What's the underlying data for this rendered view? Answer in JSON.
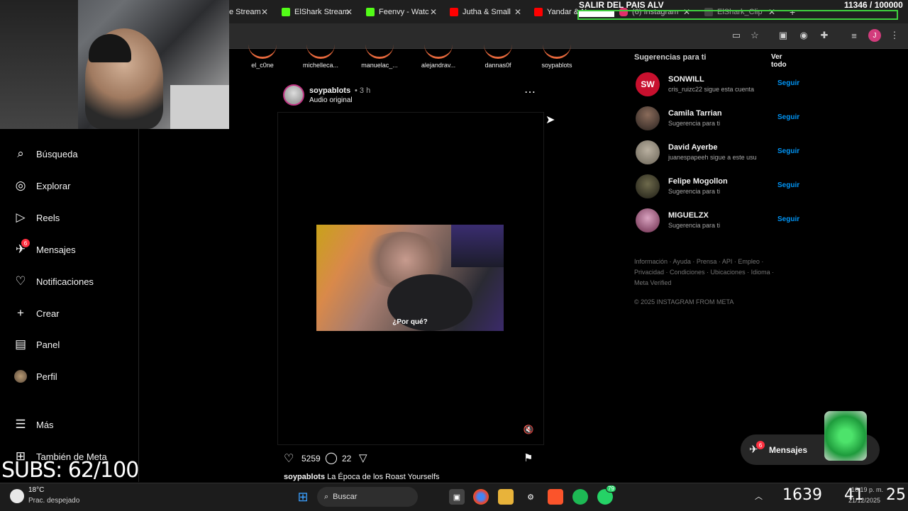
{
  "browser": {
    "tabs": [
      {
        "label": "e Stream",
        "color": "#ffffff"
      },
      {
        "label": "ElShark Stream",
        "color": "#53fc18"
      },
      {
        "label": "Feenvy - Watc",
        "color": "#53fc18"
      },
      {
        "label": "Jutha & Small",
        "color": "#ff0000"
      },
      {
        "label": "Yandar & N",
        "color": "#ff0000"
      },
      {
        "label": "(6) Instagram",
        "color": "#e1306c"
      },
      {
        "label": "ElShark_Clip",
        "color": "#ffffff"
      }
    ]
  },
  "overlay": {
    "stream_title": "SALIR DEL PAIS ALV",
    "counter": "11346 / 100000",
    "subs": "SUBS: 62/100"
  },
  "sidebar": {
    "items": [
      {
        "label": "Búsqueda",
        "icon": "search-icon"
      },
      {
        "label": "Explorar",
        "icon": "compass-icon"
      },
      {
        "label": "Reels",
        "icon": "reels-icon"
      },
      {
        "label": "Mensajes",
        "icon": "messenger-icon",
        "badge": "6"
      },
      {
        "label": "Notificaciones",
        "icon": "heart-icon"
      },
      {
        "label": "Crear",
        "icon": "plus-icon"
      },
      {
        "label": "Panel",
        "icon": "chart-icon"
      },
      {
        "label": "Perfil",
        "icon": "avatar-icon"
      },
      {
        "label": "Más",
        "icon": "menu-icon"
      },
      {
        "label": "También de Meta",
        "icon": "meta-icon"
      }
    ]
  },
  "stories": [
    "el_c0ne",
    "michelleca...",
    "manuelac_...",
    "alejandrav...",
    "dannas0f",
    "soypablots"
  ],
  "post": {
    "username": "soypablots",
    "time": "• 3 h",
    "audio": "Audio original",
    "subtitle": "¿Por qué?",
    "likes": "5259",
    "comments": "22",
    "caption_user": "soypablots",
    "caption_text": "La Época de los Roast Yourselfs"
  },
  "suggestions": {
    "title": "Sugerencias para ti",
    "see_all": "Ver todo",
    "follow_label": "Seguir",
    "items": [
      {
        "name": "SONWILL",
        "sub": "cris_ruizc22 sigue esta cuenta",
        "color": "#c8102e"
      },
      {
        "name": "Camila Tarrian",
        "sub": "Sugerencia para ti",
        "color": "#4a3b35"
      },
      {
        "name": "David Ayerbe",
        "sub": "juanespapeeh sigue a este usu",
        "color": "#8d8577"
      },
      {
        "name": "Felipe Mogollon",
        "sub": "Sugerencia para ti",
        "color": "#3b3a2a"
      },
      {
        "name": "MIGUELZX",
        "sub": "Sugerencia para ti",
        "color": "#8a4a6a"
      }
    ]
  },
  "footer": {
    "links": "Información · Ayuda · Prensa · API · Empleo · Privacidad · Condiciones · Ubicaciones · Idioma · Meta Verified",
    "copyright": "© 2025 INSTAGRAM FROM META"
  },
  "messages_pill": {
    "label": "Mensajes",
    "badge": "6"
  },
  "taskbar": {
    "weather_temp": "18°C",
    "weather_desc": "Prac. despejado",
    "search_placeholder": "Buscar",
    "whatsapp_badge": "79",
    "clock_big_1": "1639",
    "clock_big_2": "41",
    "clock_big_3": "25",
    "time": "10:19 p. m.",
    "date": "21/12/2025"
  }
}
